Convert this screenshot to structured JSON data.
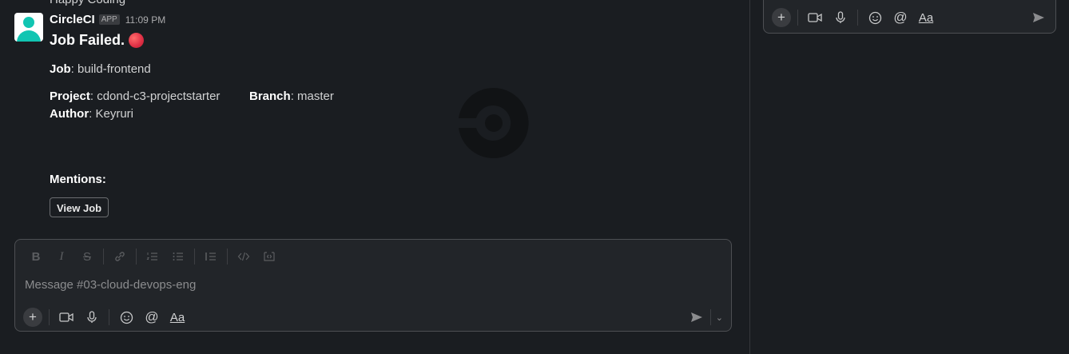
{
  "previous_message": {
    "text": "Happy Coding"
  },
  "message": {
    "sender": "CircleCI",
    "badge": "APP",
    "timestamp": "11:09 PM",
    "title": "Job Failed.",
    "job_label": "Job",
    "job_value": ": build-frontend",
    "project_label": "Project",
    "project_value": ": cdond-c3-projectstarter",
    "branch_label": "Branch",
    "branch_value": ": master",
    "author_label": "Author",
    "author_value": ": Keyruri",
    "mentions_label": "Mentions:",
    "view_button": "View Job"
  },
  "composer": {
    "placeholder": "Message #03-cloud-devops-eng",
    "format_icons": [
      "bold-icon",
      "italic-icon",
      "strikethrough-icon",
      "link-icon",
      "ordered-list-icon",
      "bulleted-list-icon",
      "blockquote-icon",
      "code-icon",
      "code-block-icon"
    ],
    "action_icons": [
      "plus-icon",
      "video-icon",
      "microphone-icon",
      "emoji-icon",
      "mention-icon",
      "text-format-icon"
    ],
    "text_format_label": "Aa"
  },
  "thread_composer": {
    "text_format_label": "Aa"
  },
  "colors": {
    "background": "#1a1d21",
    "accent_avatar": "#11c5b2",
    "status_red": "#dd2e44"
  }
}
